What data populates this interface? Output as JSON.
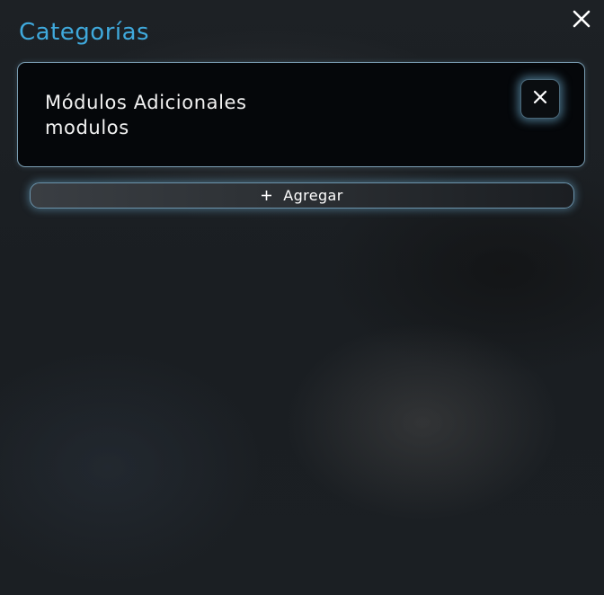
{
  "header": {
    "title": "Categorías",
    "close_icon": "close-icon"
  },
  "colors": {
    "accent": "#3fa9dc",
    "card_border": "#7a9db2",
    "glow": "#78bee1"
  },
  "categories": [
    {
      "name": "Módulos Adicionales",
      "slug": "modulos",
      "remove_icon": "close-icon"
    }
  ],
  "add_button": {
    "label": "Agregar",
    "icon": "plus-icon"
  }
}
